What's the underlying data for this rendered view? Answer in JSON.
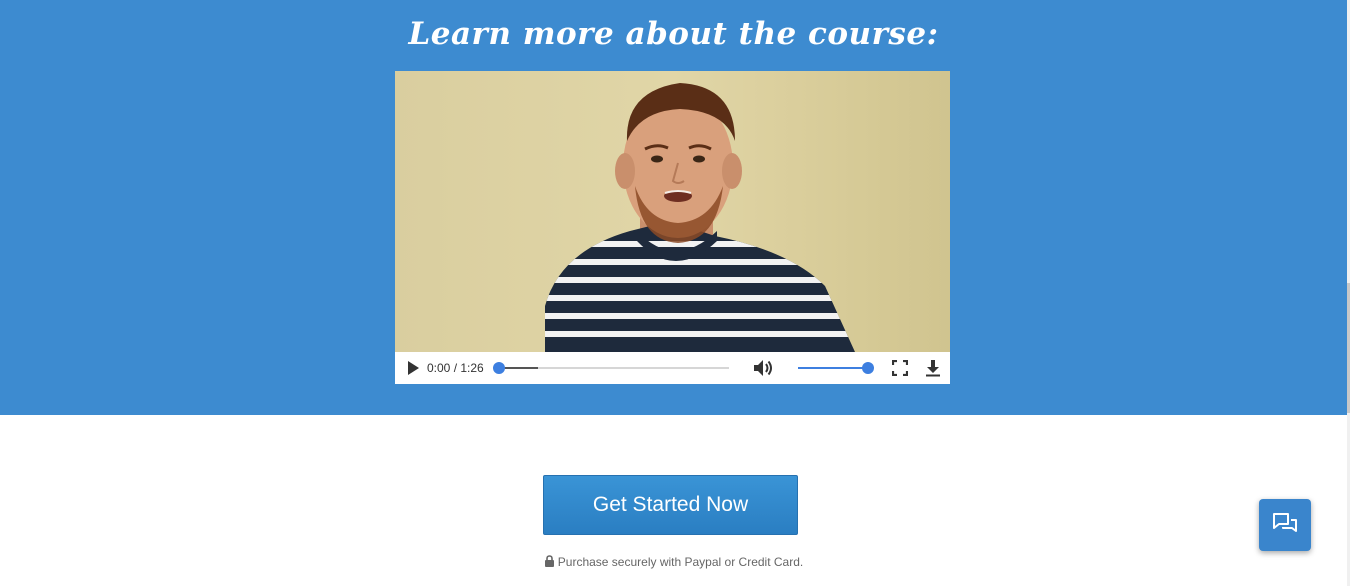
{
  "hero": {
    "title": "Learn more about the course:",
    "background_color": "#3d8bd0"
  },
  "video": {
    "time_display": "0:00 / 1:26",
    "current_time": "0:00",
    "duration": "1:26",
    "progress_fraction": 0.0,
    "buffered_fraction": 0.17,
    "volume_fraction": 1.0,
    "icons": {
      "play": "play-icon",
      "volume": "volume-icon",
      "fullscreen": "fullscreen-icon",
      "download": "download-icon"
    },
    "accent_color": "#3d7fe0"
  },
  "cta": {
    "label": "Get Started Now"
  },
  "secure_note": {
    "icon": "lock-icon",
    "text": "Purchase securely with Paypal or Credit Card."
  },
  "chat": {
    "icon": "chat-bubbles-icon"
  }
}
